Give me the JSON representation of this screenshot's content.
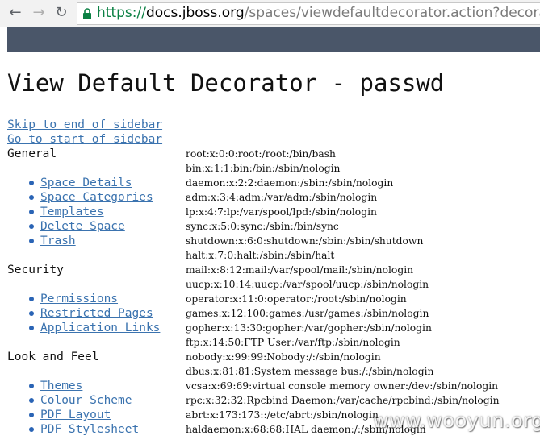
{
  "browser": {
    "url": {
      "scheme": "https://",
      "host": "docs.jboss.org",
      "path": "/spaces/viewdefaultdecorator.action?decoratorNa"
    }
  },
  "page": {
    "title": "View Default Decorator - passwd"
  },
  "sidebar": {
    "skip_end": "Skip to end of sidebar",
    "skip_start": "Go to start of sidebar",
    "sections": [
      {
        "title": "General",
        "items": [
          "Space Details",
          "Space Categories",
          "Templates",
          "Delete Space",
          "Trash"
        ]
      },
      {
        "title": "Security",
        "items": [
          "Permissions",
          "Restricted Pages",
          "Application Links"
        ]
      },
      {
        "title": "Look and Feel",
        "items": [
          "Themes",
          "Colour Scheme",
          "PDF Layout",
          "PDF Stylesheet"
        ]
      }
    ]
  },
  "content": {
    "lines": [
      "root:x:0:0:root:/root:/bin/bash",
      "bin:x:1:1:bin:/bin:/sbin/nologin",
      "daemon:x:2:2:daemon:/sbin:/sbin/nologin",
      "adm:x:3:4:adm:/var/adm:/sbin/nologin",
      "lp:x:4:7:lp:/var/spool/lpd:/sbin/nologin",
      "sync:x:5:0:sync:/sbin:/bin/sync",
      "shutdown:x:6:0:shutdown:/sbin:/sbin/shutdown",
      "halt:x:7:0:halt:/sbin:/sbin/halt",
      "mail:x:8:12:mail:/var/spool/mail:/sbin/nologin",
      "uucp:x:10:14:uucp:/var/spool/uucp:/sbin/nologin",
      "operator:x:11:0:operator:/root:/sbin/nologin",
      "games:x:12:100:games:/usr/games:/sbin/nologin",
      "gopher:x:13:30:gopher:/var/gopher:/sbin/nologin",
      "ftp:x:14:50:FTP User:/var/ftp:/sbin/nologin",
      "nobody:x:99:99:Nobody:/:/sbin/nologin",
      "dbus:x:81:81:System message bus:/:/sbin/nologin",
      "vcsa:x:69:69:virtual console memory owner:/dev:/sbin/nologin",
      "rpc:x:32:32:Rpcbind Daemon:/var/cache/rpcbind:/sbin/nologin",
      "abrt:x:173:173::/etc/abrt:/sbin/nologin",
      "haldaemon:x:68:68:HAL daemon:/:/sbin/nologin"
    ]
  },
  "watermark": "www.wooyun.org",
  "colors": {
    "link": "#3b73af",
    "header_band": "#4a5669",
    "secure_scheme": "#0b8043"
  }
}
